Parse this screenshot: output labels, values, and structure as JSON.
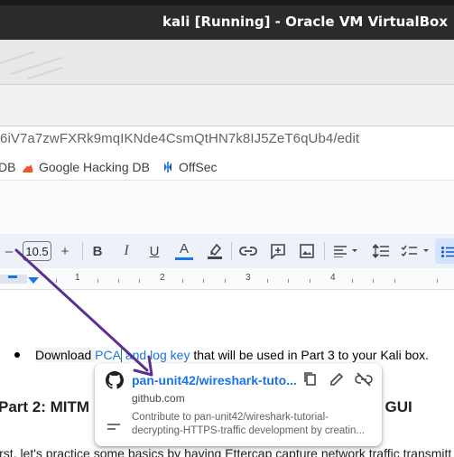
{
  "vm_window": {
    "title": "kali [Running] - Oracle VM VirtualBox"
  },
  "address_bar": {
    "url": "6iV7a7zwFXRk9mqIKNde4CsmQtHN7k8IJ5ZeT6qUb4/edit"
  },
  "bookmarks": [
    {
      "label": "DB",
      "icon": "bookmark-icon"
    },
    {
      "label": "Google Hacking DB",
      "icon": "flame-icon"
    },
    {
      "label": "OffSec",
      "icon": "offsec-icon"
    }
  ],
  "toolbar": {
    "font_size": "10.5",
    "bold": "B",
    "italic": "I",
    "underline": "U",
    "text_color": "A",
    "minus": "–",
    "plus": "+"
  },
  "ruler": {
    "numbers": [
      "1",
      "2",
      "3",
      "4"
    ]
  },
  "document": {
    "bullet_prefix": "Download ",
    "link1": "PCA",
    "link2": " and log key",
    "bullet_suffix": " that will be used in Part 3 to your Kali box.",
    "heading_left": "Part 2: MITM",
    "heading_right": "ap GUI",
    "paragraph": "irst, let's practice some basics by having Ettercap capture network traffic transmitt"
  },
  "link_preview": {
    "title": "pan-unit42/wireshark-tuto...",
    "domain": "github.com",
    "description": "Contribute to pan-unit42/wireshark-tutorial-decrypting-HTTPS-traffic development by creatin...",
    "link_color": "#1a73e8"
  },
  "colors": {
    "arrow": "#5b2f91",
    "toolbar_bg": "#edf2fa",
    "vm_titlebar": "#2b2b2b"
  }
}
